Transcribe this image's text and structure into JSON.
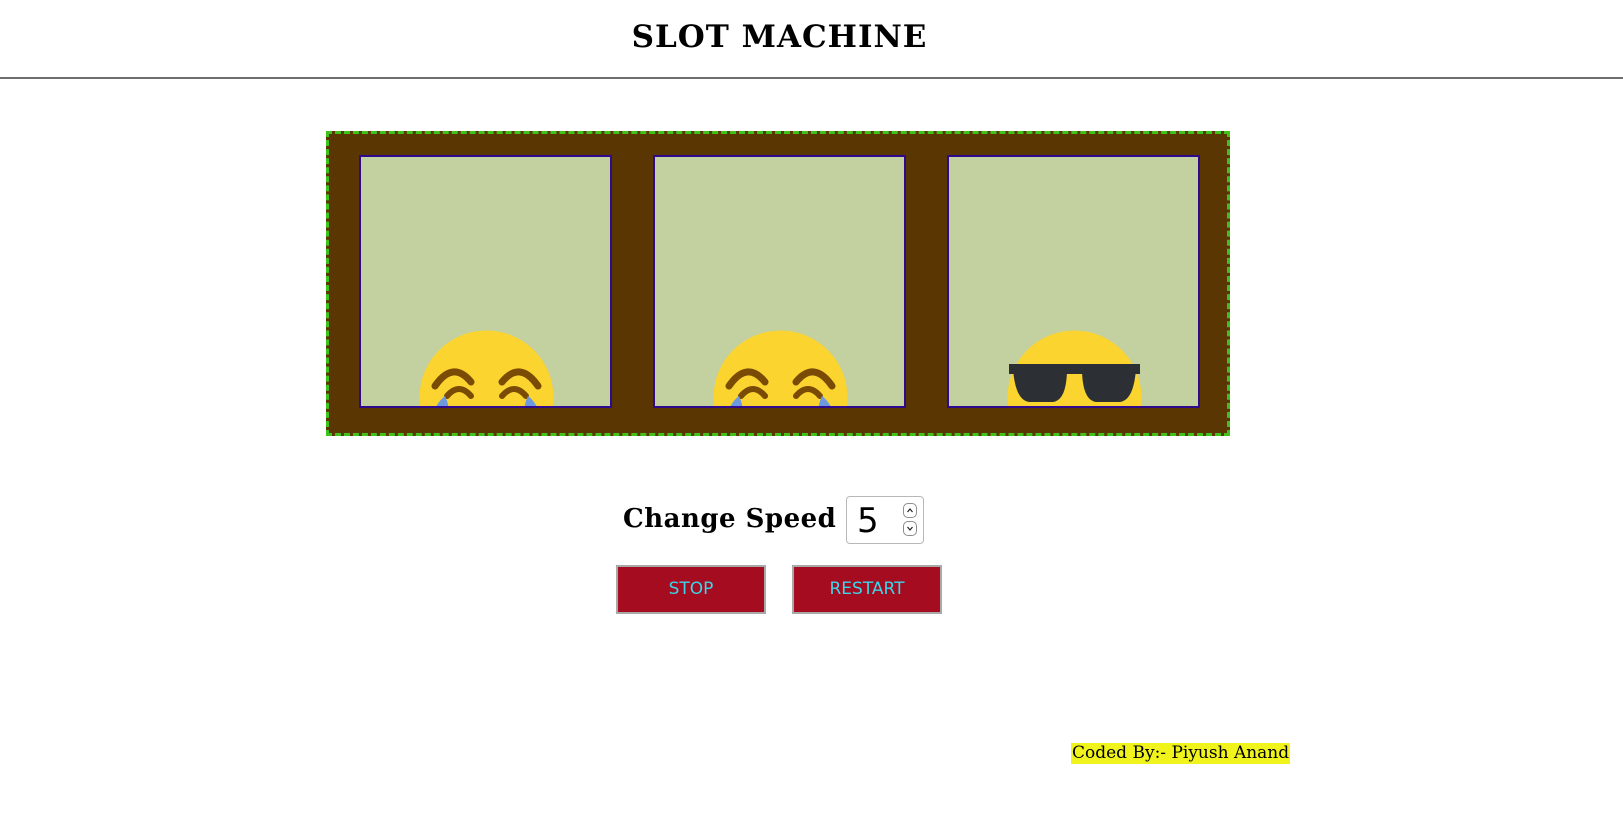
{
  "header": {
    "title": "SLOT MACHINE"
  },
  "reels": [
    {
      "symbol": "face-with-tears-of-joy"
    },
    {
      "symbol": "face-with-tears-of-joy"
    },
    {
      "symbol": "smiling-face-with-sunglasses"
    }
  ],
  "controls": {
    "speed_label": "Change Speed",
    "speed_value": "5",
    "stop_label": "STOP",
    "restart_label": "RESTART"
  },
  "footer": {
    "credit": "Coded By:- Piyush Anand"
  },
  "colors": {
    "machine_bg": "#5a3602",
    "machine_border": "#3fc21a",
    "reel_bg": "#c3d0a0",
    "reel_border": "#2f0a8e",
    "button_bg": "#a50c1f",
    "button_text": "#3bd6ec",
    "credit_highlight": "#f0f41c"
  }
}
